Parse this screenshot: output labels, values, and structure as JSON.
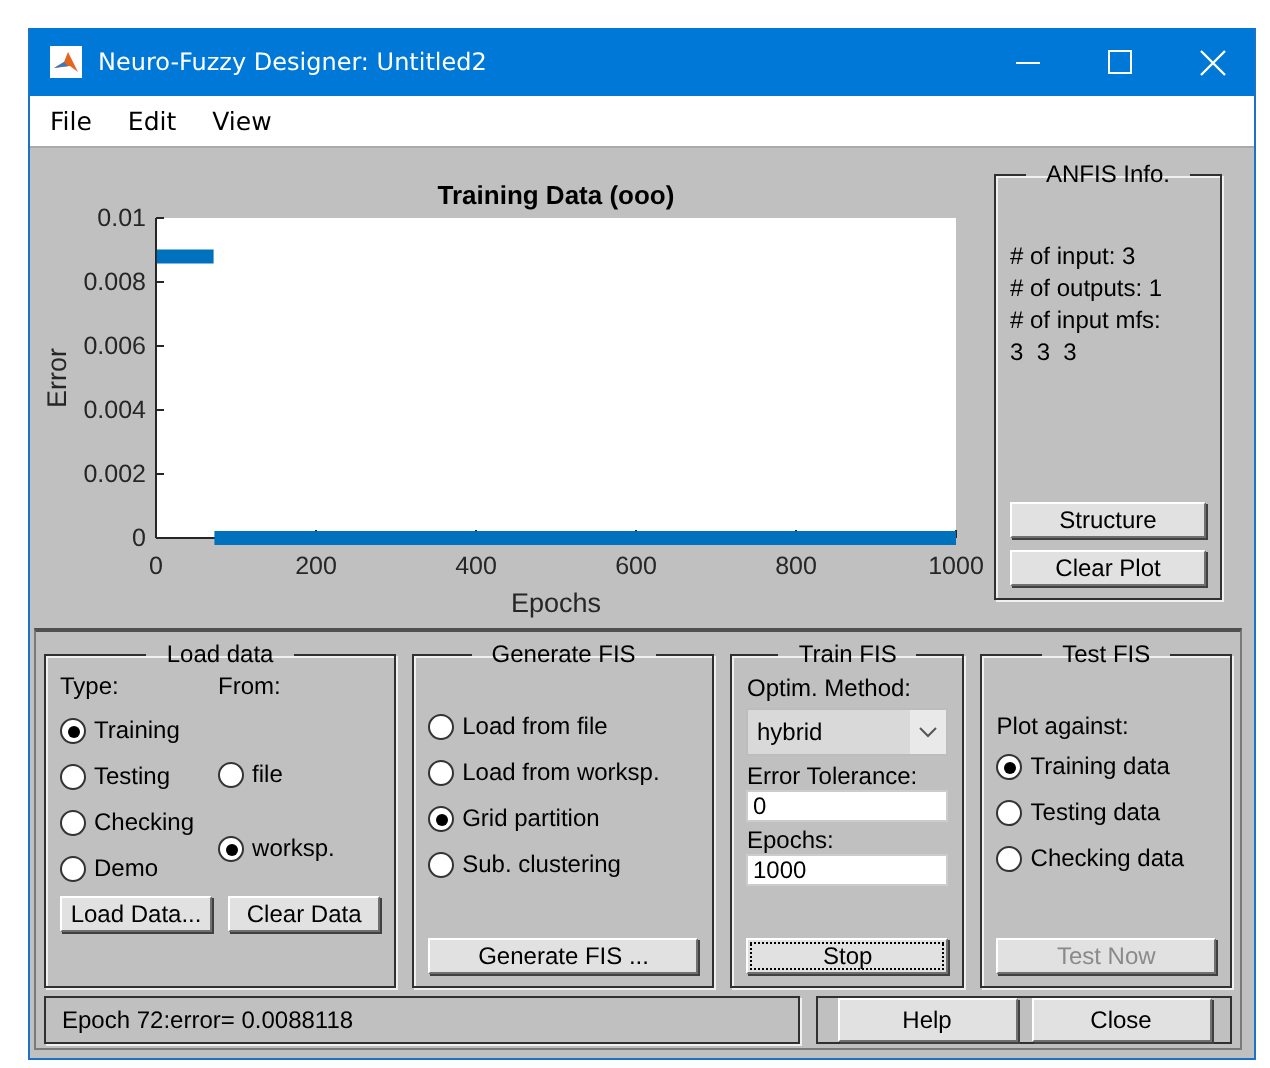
{
  "window": {
    "title": "Neuro-Fuzzy Designer: Untitled2"
  },
  "menu": [
    "File",
    "Edit",
    "View"
  ],
  "plot": {
    "chart_data": {
      "type": "line",
      "title": "Training Data (ooo)",
      "xlabel": "Epochs",
      "ylabel": "Error",
      "x": [
        1,
        72,
        73,
        1000
      ],
      "series": [
        {
          "color": "#0072bd",
          "values": [
            0.0088,
            0.0088,
            null,
            null
          ]
        },
        {
          "color": "#0072bd",
          "values": [
            null,
            null,
            0,
            0
          ]
        }
      ],
      "xlim": [
        0,
        1000
      ],
      "ylim": [
        0,
        0.01
      ],
      "xticks": [
        0,
        200,
        400,
        600,
        800,
        1000
      ],
      "yticks": [
        0,
        0.002,
        0.004,
        0.006,
        0.008,
        0.01
      ]
    }
  },
  "anfis_info": {
    "title": "ANFIS Info.",
    "lines": [
      "# of input: 3",
      "# of outputs: 1",
      "# of input mfs:",
      "3  3  3"
    ],
    "buttons": [
      "Structure",
      "Clear Plot"
    ]
  },
  "load_data": {
    "title": "Load data",
    "type_label": "Type:",
    "from_label": "From:",
    "types": [
      {
        "label": "Training",
        "selected": true
      },
      {
        "label": "Testing",
        "selected": false
      },
      {
        "label": "Checking",
        "selected": false
      },
      {
        "label": "Demo",
        "selected": false
      }
    ],
    "sources": [
      {
        "label": "file",
        "selected": false
      },
      {
        "label": "worksp.",
        "selected": true
      }
    ],
    "buttons": [
      "Load Data...",
      "Clear Data"
    ]
  },
  "generate_fis": {
    "title": "Generate FIS",
    "options": [
      {
        "label": "Load from file",
        "selected": false
      },
      {
        "label": "Load from worksp.",
        "selected": false
      },
      {
        "label": "Grid partition",
        "selected": true
      },
      {
        "label": "Sub. clustering",
        "selected": false
      }
    ],
    "button": "Generate FIS ..."
  },
  "train_fis": {
    "title": "Train FIS",
    "method_label": "Optim. Method:",
    "method": "hybrid",
    "tolerance_label": "Error Tolerance:",
    "tolerance": "0",
    "epochs_label": "Epochs:",
    "epochs": "1000",
    "button": {
      "label": "Stop",
      "focused": true
    }
  },
  "test_fis": {
    "title": "Test FIS",
    "plot_against_label": "Plot against:",
    "options": [
      {
        "label": "Training data",
        "selected": true
      },
      {
        "label": "Testing data",
        "selected": false
      },
      {
        "label": "Checking data",
        "selected": false
      }
    ],
    "button": {
      "label": "Test Now",
      "disabled": true
    }
  },
  "status": "Epoch 72:error= 0.0088118",
  "buttons": [
    "Help",
    "Close"
  ]
}
